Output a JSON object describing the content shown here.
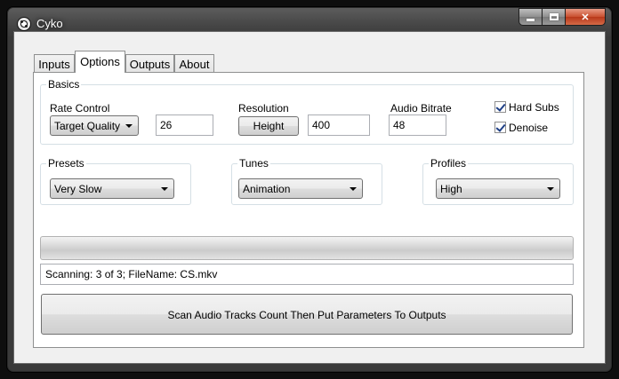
{
  "window": {
    "title": "Cyko"
  },
  "caption_buttons": {
    "minimize_icon": "minimize-icon",
    "maximize_icon": "maximize-icon",
    "close_icon": "close-icon",
    "close_glyph": "✕"
  },
  "tabs": [
    {
      "label": "Inputs"
    },
    {
      "label": "Options",
      "active": true
    },
    {
      "label": "Outputs"
    },
    {
      "label": "About"
    }
  ],
  "basics": {
    "legend": "Basics",
    "rate_control": {
      "label": "Rate Control",
      "selected": "Target Quality",
      "value": "26"
    },
    "resolution": {
      "label": "Resolution",
      "button": "Height",
      "value": "400"
    },
    "audio_bitrate": {
      "label": "Audio Bitrate",
      "value": "48"
    },
    "hard_subs": {
      "label": "Hard Subs",
      "checked": true
    },
    "denoise": {
      "label": "Denoise",
      "checked": true
    }
  },
  "presets": {
    "legend": "Presets",
    "selected": "Very Slow"
  },
  "tunes": {
    "legend": "Tunes",
    "selected": "Animation"
  },
  "profiles": {
    "legend": "Profiles",
    "selected": "High"
  },
  "progress": {
    "percent": 0
  },
  "status_text": "Scanning: 3 of 3; FileName: CS.mkv",
  "action_button": "Scan Audio Tracks Count Then Put Parameters To Outputs",
  "colors": {
    "progress_green": "#2ea51a",
    "close_red": "#c9502f",
    "group_border": "#d5dfe5"
  }
}
